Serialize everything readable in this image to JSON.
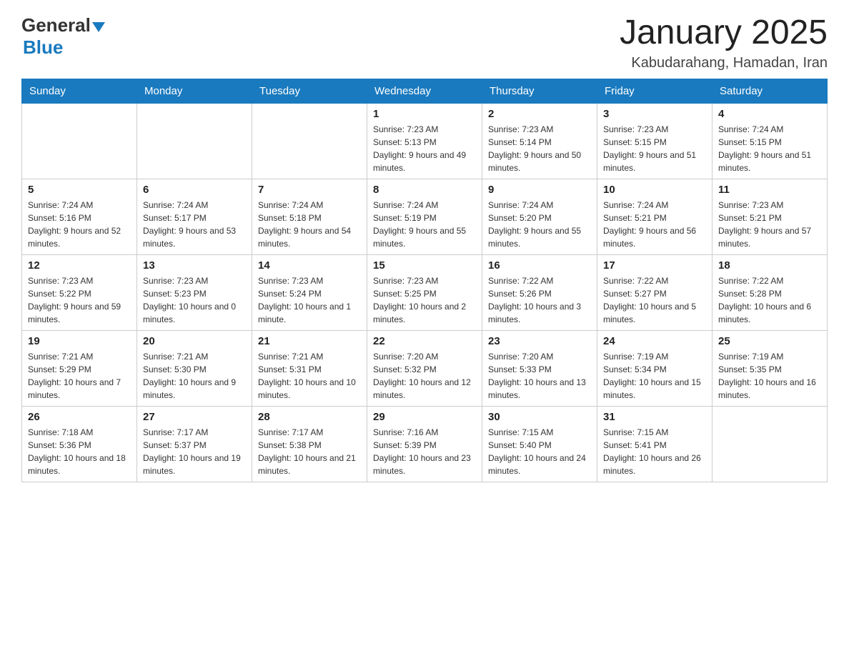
{
  "header": {
    "logo_general": "General",
    "logo_blue": "Blue",
    "month_title": "January 2025",
    "location": "Kabudarahang, Hamadan, Iran"
  },
  "days_of_week": [
    "Sunday",
    "Monday",
    "Tuesday",
    "Wednesday",
    "Thursday",
    "Friday",
    "Saturday"
  ],
  "weeks": [
    [
      {
        "day": "",
        "info": ""
      },
      {
        "day": "",
        "info": ""
      },
      {
        "day": "",
        "info": ""
      },
      {
        "day": "1",
        "info": "Sunrise: 7:23 AM\nSunset: 5:13 PM\nDaylight: 9 hours and 49 minutes."
      },
      {
        "day": "2",
        "info": "Sunrise: 7:23 AM\nSunset: 5:14 PM\nDaylight: 9 hours and 50 minutes."
      },
      {
        "day": "3",
        "info": "Sunrise: 7:23 AM\nSunset: 5:15 PM\nDaylight: 9 hours and 51 minutes."
      },
      {
        "day": "4",
        "info": "Sunrise: 7:24 AM\nSunset: 5:15 PM\nDaylight: 9 hours and 51 minutes."
      }
    ],
    [
      {
        "day": "5",
        "info": "Sunrise: 7:24 AM\nSunset: 5:16 PM\nDaylight: 9 hours and 52 minutes."
      },
      {
        "day": "6",
        "info": "Sunrise: 7:24 AM\nSunset: 5:17 PM\nDaylight: 9 hours and 53 minutes."
      },
      {
        "day": "7",
        "info": "Sunrise: 7:24 AM\nSunset: 5:18 PM\nDaylight: 9 hours and 54 minutes."
      },
      {
        "day": "8",
        "info": "Sunrise: 7:24 AM\nSunset: 5:19 PM\nDaylight: 9 hours and 55 minutes."
      },
      {
        "day": "9",
        "info": "Sunrise: 7:24 AM\nSunset: 5:20 PM\nDaylight: 9 hours and 55 minutes."
      },
      {
        "day": "10",
        "info": "Sunrise: 7:24 AM\nSunset: 5:21 PM\nDaylight: 9 hours and 56 minutes."
      },
      {
        "day": "11",
        "info": "Sunrise: 7:23 AM\nSunset: 5:21 PM\nDaylight: 9 hours and 57 minutes."
      }
    ],
    [
      {
        "day": "12",
        "info": "Sunrise: 7:23 AM\nSunset: 5:22 PM\nDaylight: 9 hours and 59 minutes."
      },
      {
        "day": "13",
        "info": "Sunrise: 7:23 AM\nSunset: 5:23 PM\nDaylight: 10 hours and 0 minutes."
      },
      {
        "day": "14",
        "info": "Sunrise: 7:23 AM\nSunset: 5:24 PM\nDaylight: 10 hours and 1 minute."
      },
      {
        "day": "15",
        "info": "Sunrise: 7:23 AM\nSunset: 5:25 PM\nDaylight: 10 hours and 2 minutes."
      },
      {
        "day": "16",
        "info": "Sunrise: 7:22 AM\nSunset: 5:26 PM\nDaylight: 10 hours and 3 minutes."
      },
      {
        "day": "17",
        "info": "Sunrise: 7:22 AM\nSunset: 5:27 PM\nDaylight: 10 hours and 5 minutes."
      },
      {
        "day": "18",
        "info": "Sunrise: 7:22 AM\nSunset: 5:28 PM\nDaylight: 10 hours and 6 minutes."
      }
    ],
    [
      {
        "day": "19",
        "info": "Sunrise: 7:21 AM\nSunset: 5:29 PM\nDaylight: 10 hours and 7 minutes."
      },
      {
        "day": "20",
        "info": "Sunrise: 7:21 AM\nSunset: 5:30 PM\nDaylight: 10 hours and 9 minutes."
      },
      {
        "day": "21",
        "info": "Sunrise: 7:21 AM\nSunset: 5:31 PM\nDaylight: 10 hours and 10 minutes."
      },
      {
        "day": "22",
        "info": "Sunrise: 7:20 AM\nSunset: 5:32 PM\nDaylight: 10 hours and 12 minutes."
      },
      {
        "day": "23",
        "info": "Sunrise: 7:20 AM\nSunset: 5:33 PM\nDaylight: 10 hours and 13 minutes."
      },
      {
        "day": "24",
        "info": "Sunrise: 7:19 AM\nSunset: 5:34 PM\nDaylight: 10 hours and 15 minutes."
      },
      {
        "day": "25",
        "info": "Sunrise: 7:19 AM\nSunset: 5:35 PM\nDaylight: 10 hours and 16 minutes."
      }
    ],
    [
      {
        "day": "26",
        "info": "Sunrise: 7:18 AM\nSunset: 5:36 PM\nDaylight: 10 hours and 18 minutes."
      },
      {
        "day": "27",
        "info": "Sunrise: 7:17 AM\nSunset: 5:37 PM\nDaylight: 10 hours and 19 minutes."
      },
      {
        "day": "28",
        "info": "Sunrise: 7:17 AM\nSunset: 5:38 PM\nDaylight: 10 hours and 21 minutes."
      },
      {
        "day": "29",
        "info": "Sunrise: 7:16 AM\nSunset: 5:39 PM\nDaylight: 10 hours and 23 minutes."
      },
      {
        "day": "30",
        "info": "Sunrise: 7:15 AM\nSunset: 5:40 PM\nDaylight: 10 hours and 24 minutes."
      },
      {
        "day": "31",
        "info": "Sunrise: 7:15 AM\nSunset: 5:41 PM\nDaylight: 10 hours and 26 minutes."
      },
      {
        "day": "",
        "info": ""
      }
    ]
  ]
}
